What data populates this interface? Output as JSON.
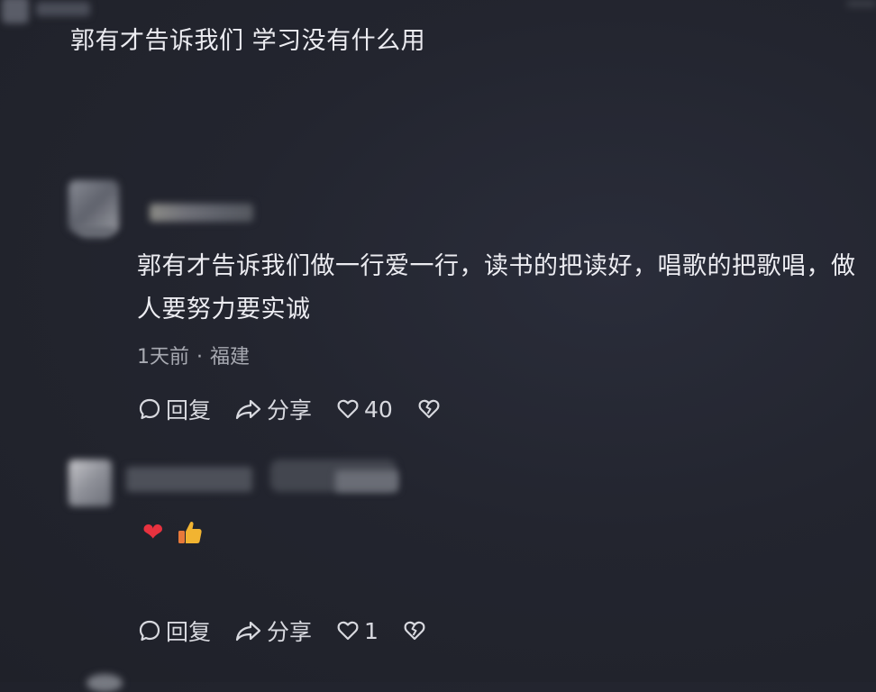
{
  "comments": [
    {
      "text": "郭有才告诉我们 学习没有什么用"
    },
    {
      "text": "郭有才告诉我们做一行爱一行，读书的把读好，唱歌的把歌唱，做人要努力要实诚",
      "time": "1天前",
      "separator": "·",
      "location": "福建",
      "actions": {
        "reply_label": "回复",
        "share_label": "分享",
        "like_count": "40"
      }
    },
    {
      "emoji_icons": [
        "red-heart-icon",
        "thumbs-up-icon"
      ],
      "actions": {
        "reply_label": "回复",
        "share_label": "分享",
        "like_count": "1"
      }
    }
  ],
  "colors": {
    "background": "#23252f",
    "text": "#ececf1",
    "meta": "#a8aab2",
    "heart": "#e8323f",
    "thumb": "#f2b431"
  }
}
